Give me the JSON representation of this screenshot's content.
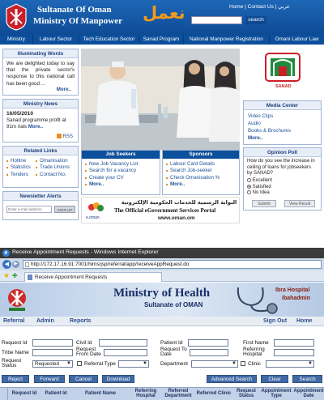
{
  "site": {
    "title_line1": "Sultanate Of Oman",
    "title_line2": "Ministry Of Manpower",
    "logo_arabic": "نعمل",
    "top_links": [
      "Home",
      "|",
      "Contact Us",
      "|",
      "عربي"
    ],
    "search_label": "search",
    "nav": [
      "Ministry",
      "Labour Sector",
      "Tech Education Sector",
      "Sanad Program",
      "National Manpower Registration",
      "Omani Labour Law"
    ],
    "illuminating": {
      "heading": "Illuminating Words",
      "text": "We are delighted today to say that the private sector's response to this national call has been good ...",
      "more": "More.."
    },
    "ministry_news": {
      "heading": "Ministry News",
      "date": "16/05/2010",
      "text": "Sanad programme profit at 91m rials",
      "more": "More..",
      "rss": "RSS"
    },
    "related_links": {
      "heading": "Related Links",
      "col1": [
        "Hotline",
        "Statistics",
        "Tenders"
      ],
      "col2": [
        "Omanisation",
        "Trade Unions",
        "Contact No."
      ]
    },
    "newsletter": {
      "heading": "Newsletter Alerts",
      "placeholder": "Enter e-mail address",
      "button": "SIGN UP"
    },
    "job_seekers": {
      "heading": "Job Seekers",
      "items": [
        "New Job Vacancy List",
        "Search for a vacancy",
        "Create your CV"
      ],
      "more": "More.."
    },
    "sponsors": {
      "heading": "Sponsors",
      "items": [
        "Labour Card Details",
        "Search Job-seeker",
        "Check Omanisation %"
      ],
      "more": "More.."
    },
    "portal": {
      "arabic": "البوابة الرسمية للخدمات الحكومية الإلكترونية",
      "english": "The Official eGovernment Services Portal",
      "url": "www.oman.om",
      "brand": "e.oman"
    },
    "sanad_label": "SANAD",
    "media_center": {
      "heading": "Media Center",
      "items": [
        "Video Clips",
        "Audio",
        "Books & Brochures"
      ],
      "more": "More.."
    },
    "poll": {
      "heading": "Opinion Poll",
      "question": "How do you see the increase in ceiling of loans for jobseekers by SANAD?",
      "options": [
        "Excellent",
        "Satisfied",
        "No Idea"
      ],
      "selected": "Satisfied",
      "submit": "Submit",
      "view": "View Result"
    }
  },
  "ie": {
    "window_title": "Receive Appointment Requests - Windows Internet Explorer",
    "url": "http://172.17.16.91:7001/hims/jsp/referral/app/receiveAppRequest.do",
    "tab_title": "Receive Appointment Requests",
    "banner_title": "Ministry of Health",
    "banner_sub": "Sultanate of OMAN",
    "hospital": "Ibra Hospital",
    "user": "ibahadmin",
    "menu": [
      "Referral",
      "Admin",
      "Reports"
    ],
    "menu_right": [
      "Sign Out",
      "Home"
    ],
    "fields": {
      "request_id": "Request Id",
      "civil_id": "Civil Id",
      "patient_id": "Patient Id",
      "first_name": "First Name",
      "tribe_name": "Tribe Name",
      "request_from_date": "Request From Date",
      "request_to_date": "Request To Date",
      "referring_hospital": "Referring Hospital",
      "request_status": "Request Status",
      "status_value": "Requested",
      "referral_type": "Referral Type",
      "department": "Department",
      "clinic": "Clinic"
    },
    "buttons_left": [
      "Reject",
      "Forward",
      "Cancel",
      "Download"
    ],
    "buttons_right": [
      "Advanced Search",
      "Clear",
      "Search"
    ],
    "table_headers": [
      "Request Id",
      "Patient Id",
      "Patient Name",
      "Referring Hospital",
      "Referred Department",
      "Referred Clinic",
      "Request Status",
      "Appointment Type",
      "Appointment Date"
    ]
  },
  "colors": {
    "nav_blue": "#0c4f9c",
    "ie_header": "#2f4f8f",
    "accent_orange": "#e07a10"
  }
}
